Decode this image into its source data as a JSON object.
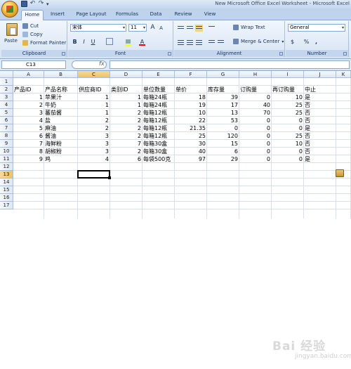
{
  "window": {
    "title": "New Microsoft Office Excel Worksheet - Microsoft Excel"
  },
  "tabs": [
    "Home",
    "Insert",
    "Page Layout",
    "Formulas",
    "Data",
    "Review",
    "View"
  ],
  "active_tab": "Home",
  "clipboard": {
    "paste": "Paste",
    "cut": "Cut",
    "copy": "Copy",
    "format_painter": "Format Painter",
    "label": "Clipboard"
  },
  "font": {
    "name": "宋体",
    "size": "11",
    "label": "Font",
    "bold": "B",
    "italic": "I",
    "underline": "U",
    "grow": "A",
    "shrink": "A",
    "font_color_btn": "A"
  },
  "alignment": {
    "wrap_text": "Wrap Text",
    "merge_center": "Merge & Center",
    "label": "Alignment"
  },
  "number": {
    "format": "General",
    "currency": "$",
    "percent": "%",
    "comma": ",",
    "label": "Number"
  },
  "formula_bar": {
    "name_box": "C13",
    "fx": "fx",
    "value": ""
  },
  "columns": [
    "A",
    "B",
    "C",
    "D",
    "E",
    "F",
    "G",
    "H",
    "I",
    "J",
    "K"
  ],
  "rows": [
    "1",
    "2",
    "3",
    "4",
    "5",
    "6",
    "7",
    "8",
    "9",
    "10",
    "11",
    "12",
    "13",
    "14",
    "15",
    "16",
    "17"
  ],
  "header_row": [
    "产品ID",
    "产品名称",
    "供应商ID",
    "类别ID",
    "单位数量",
    "单价",
    "库存量",
    "订购量",
    "再订购量",
    "中止"
  ],
  "data_rows": [
    [
      "1",
      "苹果汁",
      "1",
      "1",
      "每箱24瓶",
      "18",
      "39",
      "0",
      "10",
      "是"
    ],
    [
      "2",
      "牛奶",
      "1",
      "1",
      "每箱24瓶",
      "19",
      "17",
      "40",
      "25",
      "否"
    ],
    [
      "3",
      "蕃茄酱",
      "1",
      "2",
      "每箱12瓶",
      "10",
      "13",
      "70",
      "25",
      "否"
    ],
    [
      "4",
      "盐",
      "2",
      "2",
      "每箱12瓶",
      "22",
      "53",
      "0",
      "0",
      "否"
    ],
    [
      "5",
      "麻油",
      "2",
      "2",
      "每箱12瓶",
      "21.35",
      "0",
      "0",
      "0",
      "是"
    ],
    [
      "6",
      "酱油",
      "3",
      "2",
      "每箱12瓶",
      "25",
      "120",
      "0",
      "25",
      "否"
    ],
    [
      "7",
      "海鲜粉",
      "3",
      "7",
      "每箱30盒",
      "30",
      "15",
      "0",
      "10",
      "否"
    ],
    [
      "8",
      "胡椒粉",
      "3",
      "2",
      "每箱30盒",
      "40",
      "6",
      "0",
      "0",
      "否"
    ],
    [
      "9",
      "鸡",
      "4",
      "6",
      "每袋500克",
      "97",
      "29",
      "0",
      "0",
      "是"
    ]
  ],
  "selected_cell": "C13",
  "watermark": {
    "text": "Bai 经验",
    "sub": "jingyan.baidu.com"
  },
  "colors": {
    "ribbon": "#d7e4f4",
    "selection": "#000000",
    "header_active": "#f1c15f"
  }
}
